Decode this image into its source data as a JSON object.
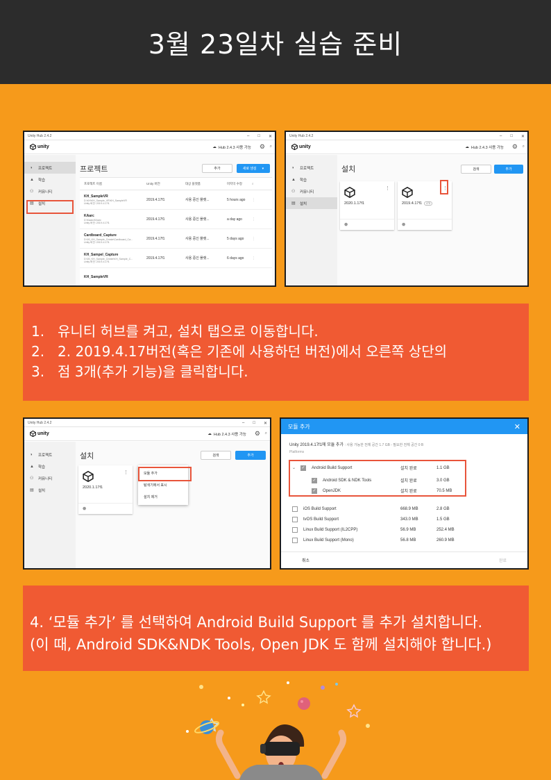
{
  "header": {
    "title": "3월 23일차 실습 준비"
  },
  "hub": {
    "window_title": "Unity Hub 2.4.2",
    "logo": "unity",
    "update": "Hub 2.4.3 사용 가능",
    "nav": [
      "프로젝트",
      "학습",
      "커뮤니티",
      "설치"
    ]
  },
  "shot1": {
    "page_title": "프로젝트",
    "btn_add": "추가",
    "btn_new": "새로 생성",
    "columns": [
      "프로젝트 이름",
      "Unity 버전",
      "대상 플랫폼",
      "마지막 수정"
    ],
    "projects": [
      {
        "name": "KH_SampleVR",
        "path": "D:\\KH\\KH_Sample_VR\\KH_SampleVR",
        "ver_label": "Unity 버전: 2019.4.17f1",
        "version": "2019.4.17f1",
        "platform": "사용 중인 플랫...",
        "modified": "5 hours ago"
      },
      {
        "name": "KAarc",
        "path": "D:\\Kaarc\\KAarc",
        "ver_label": "Unity 버전: 2019.4.17f1",
        "version": "2019.4.17f1",
        "platform": "사용 중인 플랫...",
        "modified": "a day ago"
      },
      {
        "name": "Cardboard_Capture",
        "path": "D:\\00_KH_Sample_Create\\Cardboard_Ca...",
        "ver_label": "Unity 버전: 2019.4.17f1",
        "version": "2019.4.17f1",
        "platform": "사용 중인 플랫...",
        "modified": "5 days ago"
      },
      {
        "name": "KH_Sampel_Capture",
        "path": "D:\\00_KH_Sample_Create\\KH_Sample_C...",
        "ver_label": "Unity 버전: 2019.4.17f1",
        "version": "2019.4.17f1",
        "platform": "사용 중인 플랫...",
        "modified": "6 days ago"
      },
      {
        "name": "KH_SampleVR",
        "path": "",
        "ver_label": "",
        "version": "",
        "platform": "",
        "modified": ""
      }
    ]
  },
  "shot2": {
    "page_title": "설치",
    "btn_locate": "검색",
    "btn_add": "추가",
    "cards": [
      {
        "version": "2020.1.17f1",
        "badge": ""
      },
      {
        "version": "2019.4.17f1",
        "badge": "LTS"
      }
    ]
  },
  "shot3": {
    "page_title": "설치",
    "btn_locate": "검색",
    "btn_add": "추가",
    "card_version": "2020.1.17f1",
    "menu": [
      "모듈 추가",
      "탐색기에서 표시",
      "설치 제거"
    ]
  },
  "instructions1": [
    {
      "num": "1.",
      "text": "유니티 허브를 켜고, 설치 탭으로 이동합니다."
    },
    {
      "num": "2.",
      "text": "2. 2019.4.17버전(혹은  기존에 사용하던 버전)에서 오른쪽 상단의"
    },
    {
      "num": "3.",
      "text": "점 3개(추가 기능)을 클릭합니다."
    }
  ],
  "modal": {
    "title": "모듈 추가",
    "subtitle": "Unity 2019.4.17f1에 모듈 추가",
    "space_info": ": 사용 가능한 전체 공간 1.7 GB - 필요한 전체 공간 0 B",
    "platforms_label": "Platforms",
    "rows": [
      {
        "name": "Android Build Support",
        "size": "설치 완료",
        "disk": "1.1 GB",
        "checked": true,
        "indent": 0
      },
      {
        "name": "Android SDK & NDK Tools",
        "size": "설치 완료",
        "disk": "3.0 GB",
        "checked": true,
        "indent": 1
      },
      {
        "name": "OpenJDK",
        "size": "설치 완료",
        "disk": "70.5 MB",
        "checked": true,
        "indent": 1
      },
      {
        "name": "iOS Build Support",
        "size": "668.9 MB",
        "disk": "2.8 GB",
        "checked": false,
        "indent": 0
      },
      {
        "name": "tvOS Build Support",
        "size": "343.0 MB",
        "disk": "1.5 GB",
        "checked": false,
        "indent": 0
      },
      {
        "name": "Linux Build Support (IL2CPP)",
        "size": "56.9 MB",
        "disk": "252.4 MB",
        "checked": false,
        "indent": 0
      },
      {
        "name": "Linux Build Support (Mono)",
        "size": "56.8 MB",
        "disk": "260.9 MB",
        "checked": false,
        "indent": 0
      }
    ],
    "cancel": "취소",
    "done": "완료"
  },
  "instructions2": [
    "4. ‘모듈 추가’ 를 선택하여 Android Build Support 를 추가 설치합니다.",
    "(이 때,  Android SDK&NDK Tools, Open JDK 도 함께 설치해야 합니다.)"
  ],
  "colors": {
    "header_bg": "#2c2c2c",
    "page_bg": "#f69a1b",
    "panel_bg": "#f05a33",
    "highlight": "#e8543a",
    "accent": "#2196f3"
  }
}
